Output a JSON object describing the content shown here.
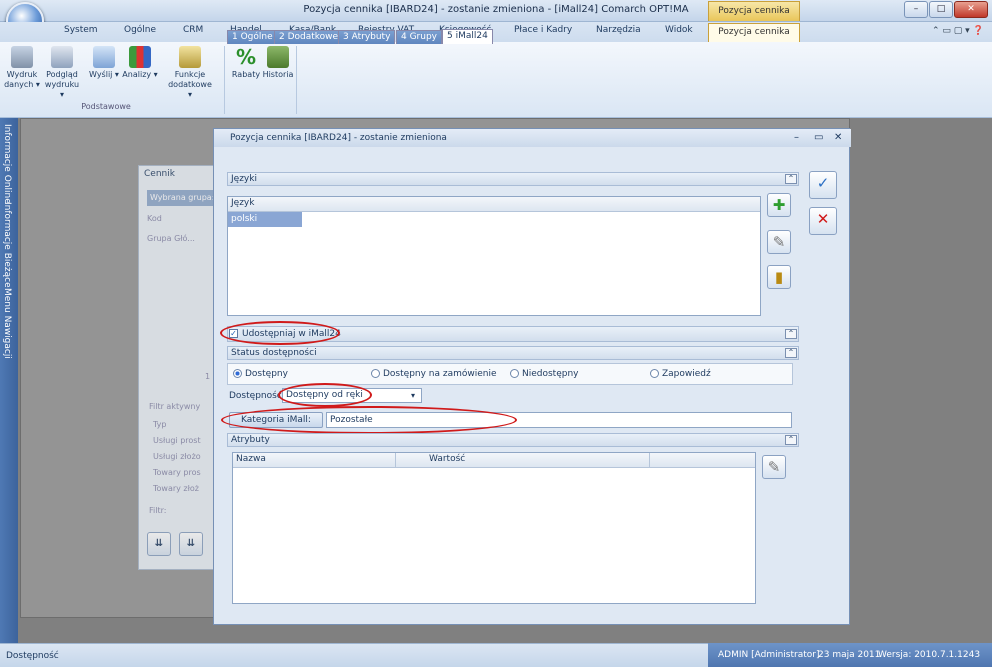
{
  "window": {
    "title": "Pozycja cennika [IBARD24] - zostanie zmieniona - [iMall24] Comarch OPT!MA",
    "context_tab": "Pozycja cennika"
  },
  "ribbon_tabs": [
    "System",
    "Ogólne",
    "CRM",
    "Handel",
    "Kasa/Bank",
    "Rejestry VAT",
    "Księgowość",
    "Płace i Kadry",
    "Narzędzia",
    "Widok",
    "Pozycja cennika"
  ],
  "ribbon": {
    "buttons": [
      {
        "label": "Wydruk danych ▾"
      },
      {
        "label": "Podgląd wydruku ▾"
      },
      {
        "label": "Wyślij ▾"
      },
      {
        "label": "Analizy ▾"
      },
      {
        "label": "Funkcje dodatkowe ▾"
      },
      {
        "label": "Rabaty"
      },
      {
        "label": "Historia"
      }
    ],
    "group_label": "Podstawowe"
  },
  "sidebar": [
    "Informacje Online",
    "Informacje Bieżące",
    "Menu Nawigacji"
  ],
  "cennik": {
    "title": "Cennik",
    "wybrana": "Wybrana grupa:",
    "kod": "Kod",
    "grupa": "Grupa Głó...",
    "filtr_aktywny": "Filtr aktywny",
    "typ": "Typ",
    "types": [
      "Usługi prost",
      "Usługi złożo",
      "Towary pros",
      "Towary złoż"
    ],
    "filtr": "Filtr:",
    "num": "1"
  },
  "dialog": {
    "title": "Pozycja cennika [IBARD24] - zostanie zmieniona",
    "tabs": [
      "1 Ogólne",
      "2 Dodatkowe",
      "3 Atrybuty",
      "4 Grupy",
      "5 iMall24"
    ],
    "jezyki": "Języki",
    "jezyk_col": "Język",
    "jezyk_row": "polski",
    "udostepniaj": "Udostępniaj w iMall24",
    "status_hdr": "Status dostępności",
    "radios": [
      "Dostępny",
      "Dostępny na zamówienie",
      "Niedostępny",
      "Zapowiedź"
    ],
    "dostepnosc_label": "Dostępność:",
    "dostepnosc_value": "Dostępny od ręki",
    "kategoria_btn": "Kategoria iMall:",
    "kategoria_value": "Pozostałe",
    "atrybuty": "Atrybuty",
    "col_nazwa": "Nazwa",
    "col_wartosc": "Wartość"
  },
  "statusbar": {
    "left": "Dostępność",
    "user": "ADMIN [Administrator]",
    "date": "23 maja 2011",
    "version": "Wersja: 2010.7.1.1243"
  }
}
